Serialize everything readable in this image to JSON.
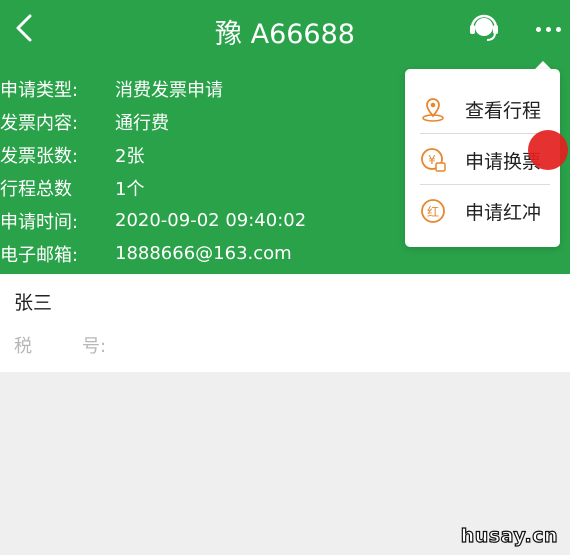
{
  "header": {
    "title": "豫 A66688",
    "back_icon": "chevron-left-icon",
    "service_icon": "customer-service-icon",
    "more_icon": "more-dots-icon"
  },
  "info_rows": [
    {
      "label": "申请类型:",
      "value": "消费发票申请"
    },
    {
      "label": "发票内容:",
      "value": "通行费"
    },
    {
      "label": "发票张数:",
      "value": "2张"
    },
    {
      "label": "行程总数",
      "value": "1个"
    },
    {
      "label": "申请时间:",
      "value": "2020-09-02 09:40:02"
    },
    {
      "label": "电子邮箱:",
      "value": "1888666@163.com"
    }
  ],
  "card": {
    "name": "张三",
    "tax_label_1": "税",
    "tax_label_2": "号:"
  },
  "menu": {
    "items": [
      {
        "label": "查看行程",
        "icon": "location-pin-icon"
      },
      {
        "label": "申请换票",
        "icon": "yuan-ticket-icon"
      },
      {
        "label": "申请红冲",
        "icon": "red-reverse-icon",
        "icon_text": "红"
      }
    ]
  },
  "watermark": "husay.cn",
  "colors": {
    "primary_green": "#2aa24a",
    "icon_orange": "#e8862d",
    "highlight_red": "#e41f1f"
  }
}
